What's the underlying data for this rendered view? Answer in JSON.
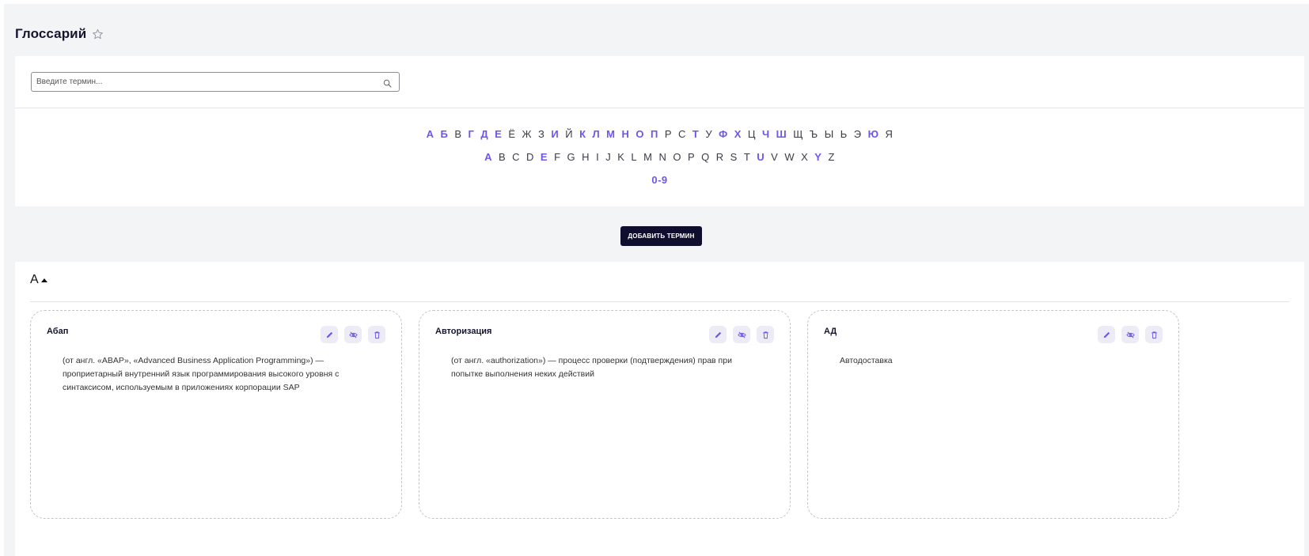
{
  "header": {
    "title": "Глоссарий",
    "favorite_icon": "star-icon"
  },
  "search": {
    "placeholder": "Введите термин...",
    "value": "",
    "icon": "search-icon"
  },
  "alphabet": {
    "russian": [
      {
        "l": "А",
        "active": true
      },
      {
        "l": "Б",
        "active": true
      },
      {
        "l": "В",
        "active": false
      },
      {
        "l": "Г",
        "active": true
      },
      {
        "l": "Д",
        "active": true
      },
      {
        "l": "Е",
        "active": true
      },
      {
        "l": "Ё",
        "active": false
      },
      {
        "l": "Ж",
        "active": false
      },
      {
        "l": "З",
        "active": false
      },
      {
        "l": "И",
        "active": true
      },
      {
        "l": "Й",
        "active": false
      },
      {
        "l": "К",
        "active": true
      },
      {
        "l": "Л",
        "active": true
      },
      {
        "l": "М",
        "active": true
      },
      {
        "l": "Н",
        "active": true
      },
      {
        "l": "О",
        "active": true
      },
      {
        "l": "П",
        "active": true
      },
      {
        "l": "Р",
        "active": false
      },
      {
        "l": "С",
        "active": false
      },
      {
        "l": "Т",
        "active": true
      },
      {
        "l": "У",
        "active": false
      },
      {
        "l": "Ф",
        "active": true
      },
      {
        "l": "Х",
        "active": true
      },
      {
        "l": "Ц",
        "active": false
      },
      {
        "l": "Ч",
        "active": true
      },
      {
        "l": "Ш",
        "active": true
      },
      {
        "l": "Щ",
        "active": false
      },
      {
        "l": "Ъ",
        "active": false
      },
      {
        "l": "Ы",
        "active": false
      },
      {
        "l": "Ь",
        "active": false
      },
      {
        "l": "Э",
        "active": false
      },
      {
        "l": "Ю",
        "active": true
      },
      {
        "l": "Я",
        "active": false
      }
    ],
    "latin": [
      {
        "l": "A",
        "active": true
      },
      {
        "l": "B",
        "active": false
      },
      {
        "l": "C",
        "active": false
      },
      {
        "l": "D",
        "active": false
      },
      {
        "l": "E",
        "active": true
      },
      {
        "l": "F",
        "active": false
      },
      {
        "l": "G",
        "active": false
      },
      {
        "l": "H",
        "active": false
      },
      {
        "l": "I",
        "active": false
      },
      {
        "l": "J",
        "active": false
      },
      {
        "l": "K",
        "active": false
      },
      {
        "l": "L",
        "active": false
      },
      {
        "l": "M",
        "active": false
      },
      {
        "l": "N",
        "active": false
      },
      {
        "l": "O",
        "active": false
      },
      {
        "l": "P",
        "active": false
      },
      {
        "l": "Q",
        "active": false
      },
      {
        "l": "R",
        "active": false
      },
      {
        "l": "S",
        "active": false
      },
      {
        "l": "T",
        "active": false
      },
      {
        "l": "U",
        "active": true
      },
      {
        "l": "V",
        "active": false
      },
      {
        "l": "W",
        "active": false
      },
      {
        "l": "X",
        "active": false
      },
      {
        "l": "Y",
        "active": true
      },
      {
        "l": "Z",
        "active": false
      }
    ],
    "digits": [
      {
        "l": "0-9",
        "active": true
      }
    ]
  },
  "add_button": {
    "label": "ДОБАВИТЬ ТЕРМИН"
  },
  "section": {
    "letter": "А",
    "toggle_icon": "caret-up-icon"
  },
  "terms": [
    {
      "title": "Абап",
      "description": "(от англ. «ABAP», «Advanced Business Application Programming») — проприетарный внутренний язык программирования высокого уровня с синтаксисом, используемым в приложениях корпорации SAP"
    },
    {
      "title": "Авторизация",
      "description": "(от англ. «authorization») — процесс проверки (подтверждения) прав при попытке выполнения неких действий"
    },
    {
      "title": "АД",
      "description": "Автодоставка"
    }
  ],
  "card_actions": {
    "edit_icon": "pencil-icon",
    "hide_icon": "eye-off-icon",
    "delete_icon": "trash-icon"
  },
  "colors": {
    "accent": "#6f55ea",
    "button_bg": "#0f0e2f",
    "page_bg": "#f3f4f6"
  }
}
